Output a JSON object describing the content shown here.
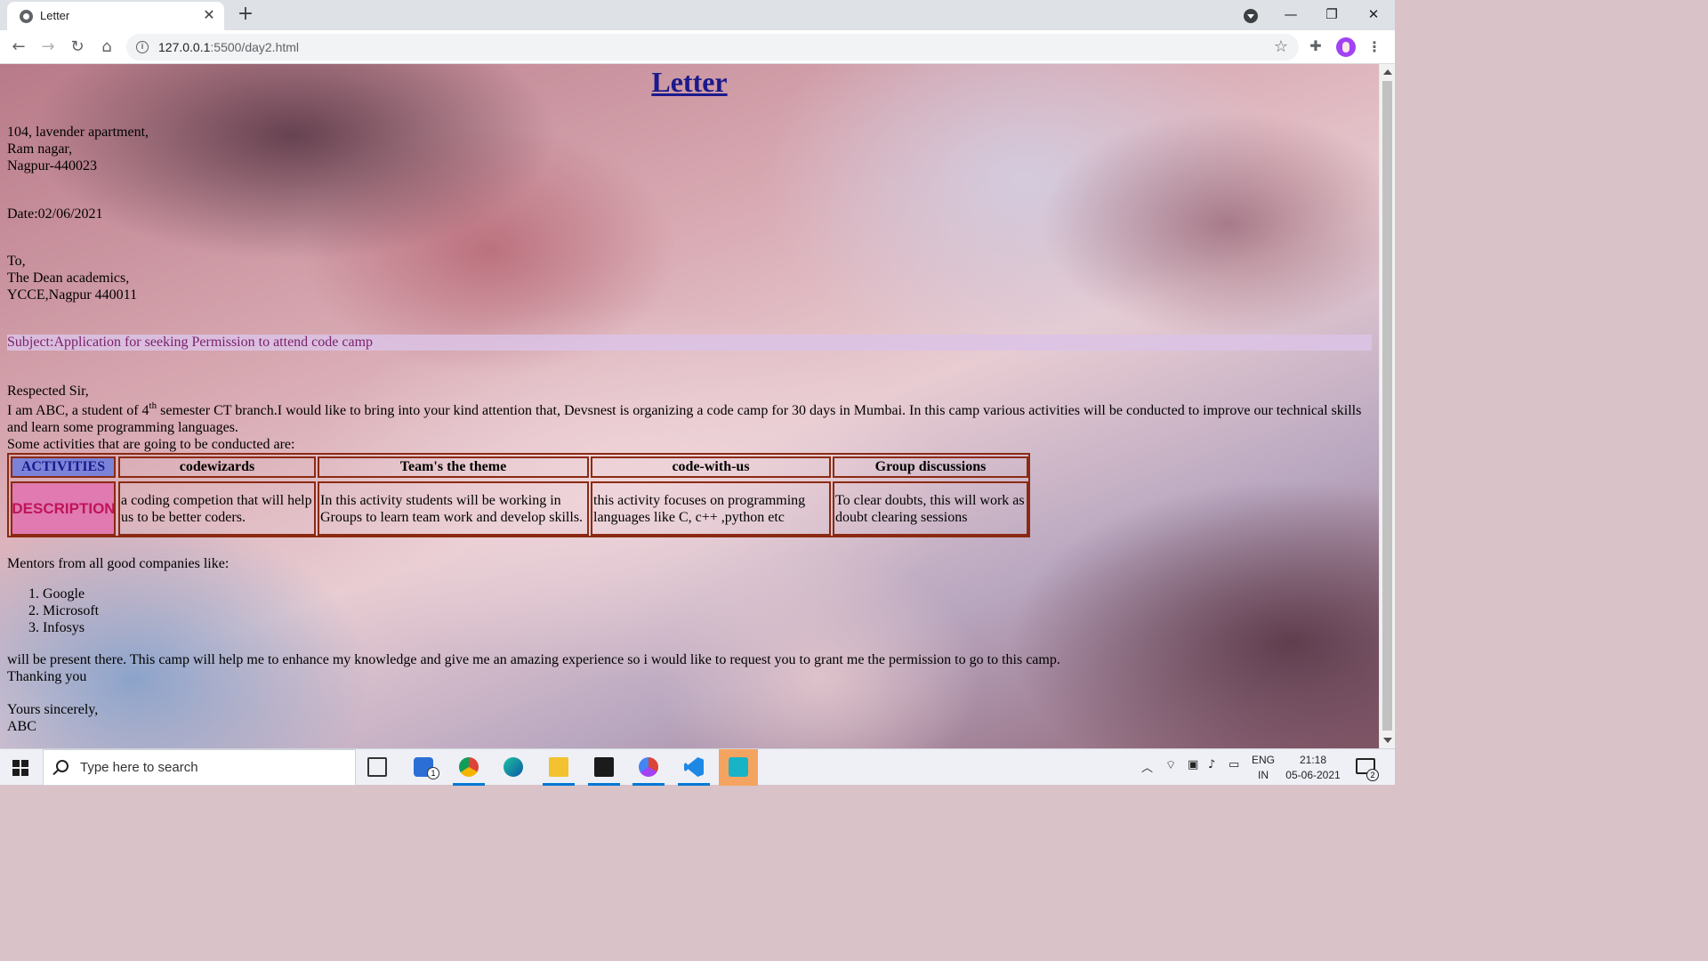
{
  "browser": {
    "tab_title": "Letter",
    "tab_close": "✕",
    "new_tab": "+",
    "url_host": "127.0.0.1",
    "url_rest": ":5500/day2.html",
    "window_controls": {
      "minimize": "—",
      "restore": "❐",
      "close": "✕"
    }
  },
  "letter": {
    "title": "Letter",
    "address": [
      "104, lavender apartment,",
      "Ram nagar,",
      "Nagpur-440023"
    ],
    "date": "Date:02/06/2021",
    "recipient": [
      "To,",
      "The Dean academics,",
      "YCCE,Nagpur 440011"
    ],
    "subject": "Subject:Application for seeking Permission to attend code camp",
    "salutation": "Respected Sir,",
    "body_intro_pre": "I am ABC, a student of 4",
    "body_intro_sup": "th",
    "body_intro_post": " semester CT branch.I would like to bring into your kind attention that, Devsnest is organizing a code camp for 30 days in Mumbai. In this camp various activities will be conducted to improve our technical skills and learn some programming languages.",
    "activities_intro": "Some activities that are going to be conducted are:",
    "table": {
      "header_label": "ACTIVITIES",
      "desc_label": "DESCRIPTION",
      "activities": [
        {
          "name": "codewizards",
          "description": "a coding competion that will help us to be better coders."
        },
        {
          "name": "Team's the theme",
          "description": "In this activity students will be working in Groups to learn team work and develop skills."
        },
        {
          "name": "code-with-us",
          "description": "this activity focuses on programming languages like C, c++ ,python etc"
        },
        {
          "name": "Group discussions",
          "description": "To clear doubts, this will work as doubt clearing sessions"
        }
      ]
    },
    "mentors_intro": "Mentors from all good companies like:",
    "companies": [
      "1. Google",
      "2. Microsoft",
      "3. Infosys"
    ],
    "closing_para": "will be present there. This camp will help me to enhance my knowledge and give me an amazing experience so i would like to request you to grant me the permission to go to this camp.",
    "thanks": "Thanking you",
    "sign_off": "Yours sincerely,",
    "signature": "ABC"
  },
  "taskbar": {
    "search_placeholder": "Type here to search",
    "lang_line1": "ENG",
    "lang_line2": "IN",
    "time": "21:18",
    "date": "05-06-2021",
    "notification_count": "2",
    "mail_badge": "1"
  }
}
